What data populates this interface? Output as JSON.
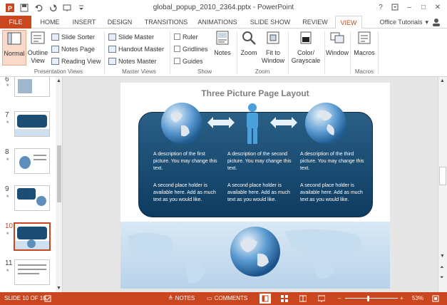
{
  "window": {
    "title": "global_popup_2010_2364.pptx - PowerPoint",
    "controls": [
      "?",
      "–",
      "□",
      "✕"
    ]
  },
  "tabs": [
    "FILE",
    "HOME",
    "INSERT",
    "DESIGN",
    "TRANSITIONS",
    "ANIMATIONS",
    "SLIDE SHOW",
    "REVIEW",
    "VIEW"
  ],
  "active_tab": "VIEW",
  "account": "Office Tutorials",
  "ribbon": {
    "presentation_views": {
      "label": "Presentation Views",
      "normal": "Normal",
      "outline": "Outline View",
      "slide_sorter": "Slide Sorter",
      "notes_page": "Notes Page",
      "reading_view": "Reading View"
    },
    "master_views": {
      "label": "Master Views",
      "slide_master": "Slide Master",
      "handout_master": "Handout Master",
      "notes_master": "Notes Master"
    },
    "show": {
      "label": "Show",
      "ruler": "Ruler",
      "gridlines": "Gridlines",
      "guides": "Guides",
      "notes": "Notes"
    },
    "zoom": {
      "label": "Zoom",
      "zoom": "Zoom",
      "fit_window": "Fit to Window"
    },
    "color": {
      "color_grayscale": "Color/ Grayscale"
    },
    "window": {
      "window": "Window"
    },
    "macros": {
      "label": "Macros",
      "macros": "Macros"
    }
  },
  "thumbnails": [
    {
      "num": "6",
      "star": "*"
    },
    {
      "num": "7",
      "star": "*"
    },
    {
      "num": "8",
      "star": "*"
    },
    {
      "num": "9",
      "star": "*"
    },
    {
      "num": "10",
      "star": "*"
    },
    {
      "num": "11",
      "star": "*"
    }
  ],
  "selected_slide": "10",
  "slide": {
    "title": "Three Picture Page Layout",
    "columns": [
      {
        "desc1": "A description of the first picture.  You may change this text.",
        "desc2": "A second place holder is available here.  Add as much text as you would like."
      },
      {
        "desc1": "A description of the second picture.  You may change this text.",
        "desc2": "A second place holder is available here.  Add as much text as you would like."
      },
      {
        "desc1": "A description of the third picture.  You may change this text.",
        "desc2": "A second place holder is available here.  Add as much text as you would like."
      }
    ]
  },
  "status": {
    "slide_info": "SLIDE 10 OF 18",
    "notes": "NOTES",
    "comments": "COMMENTS",
    "zoom": "53%"
  },
  "colors": {
    "accent": "#c9461f",
    "panel": "#1b4d75"
  }
}
